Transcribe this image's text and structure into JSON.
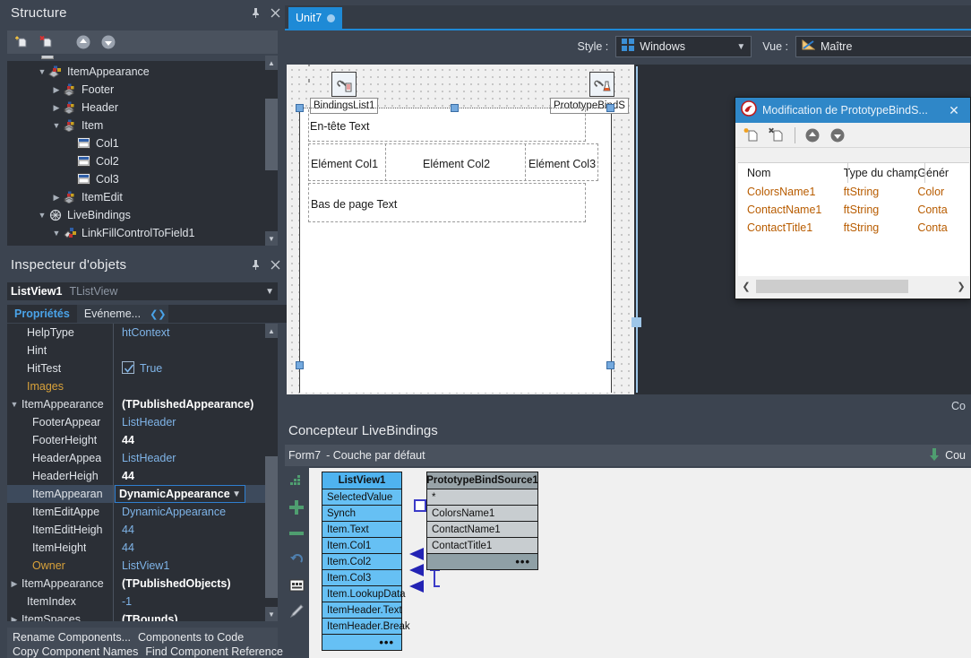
{
  "structure": {
    "title": "Structure",
    "toolbar": [
      {
        "name": "new-item-icon",
        "tip": "New item"
      },
      {
        "name": "delete-item-icon",
        "tip": "Delete item"
      },
      {
        "name": "move-up-icon",
        "tip": "Move up"
      },
      {
        "name": "move-down-icon",
        "tip": "Move down"
      }
    ],
    "tree": [
      {
        "label": "ItemAppearance",
        "indent": 2,
        "expander": "v",
        "icon": "component-icon"
      },
      {
        "label": "Footer",
        "indent": 3,
        "expander": ">",
        "icon": "appearance-icon"
      },
      {
        "label": "Header",
        "indent": 3,
        "expander": ">",
        "icon": "appearance-icon"
      },
      {
        "label": "Item",
        "indent": 3,
        "expander": "v",
        "icon": "appearance-icon"
      },
      {
        "label": "Col1",
        "indent": 4,
        "expander": "",
        "icon": "object-icon"
      },
      {
        "label": "Col2",
        "indent": 4,
        "expander": "",
        "icon": "object-icon"
      },
      {
        "label": "Col3",
        "indent": 4,
        "expander": "",
        "icon": "object-icon"
      },
      {
        "label": "ItemEdit",
        "indent": 3,
        "expander": ">",
        "icon": "appearance-icon"
      },
      {
        "label": "LiveBindings",
        "indent": 2,
        "expander": "v",
        "icon": "livebindings-icon"
      },
      {
        "label": "LinkFillControlToField1",
        "indent": 3,
        "expander": "v",
        "icon": "link-icon"
      }
    ]
  },
  "inspector": {
    "title": "Inspecteur d'objets",
    "component": {
      "name": "ListView1",
      "type": "TListView"
    },
    "tabs": [
      {
        "label": "Propriétés",
        "active": true
      },
      {
        "label": "Evéneme...",
        "active": false
      }
    ],
    "search_value": "",
    "search_placeholder": "",
    "rows": [
      {
        "key": "HelpType",
        "value": "htContext",
        "style": "lite",
        "indent": 1,
        "expander": "",
        "selected": false
      },
      {
        "key": "Hint",
        "value": "",
        "style": "lite",
        "indent": 1,
        "expander": "",
        "selected": false
      },
      {
        "key": "HitTest",
        "value": "True",
        "style": "check",
        "indent": 1,
        "expander": "",
        "selected": false
      },
      {
        "key": "Images",
        "value": "",
        "style": "lite",
        "indent": 1,
        "expander": "",
        "selected": false,
        "keyColor": "orange"
      },
      {
        "key": "ItemAppearance",
        "value": "(TPublishedAppearance)",
        "style": "bold",
        "indent": 0,
        "expander": "v",
        "selected": false
      },
      {
        "key": "FooterAppear",
        "value": "ListHeader",
        "style": "lite",
        "indent": 2,
        "expander": "",
        "selected": false
      },
      {
        "key": "FooterHeight",
        "value": "44",
        "style": "num",
        "indent": 2,
        "expander": "",
        "selected": false
      },
      {
        "key": "HeaderAppea",
        "value": "ListHeader",
        "style": "lite",
        "indent": 2,
        "expander": "",
        "selected": false
      },
      {
        "key": "HeaderHeigh",
        "value": "44",
        "style": "num",
        "indent": 2,
        "expander": "",
        "selected": false
      },
      {
        "key": "ItemAppearan",
        "value": "DynamicAppearance",
        "style": "dropdown",
        "indent": 2,
        "expander": "",
        "selected": true
      },
      {
        "key": "ItemEditAppe",
        "value": "DynamicAppearance",
        "style": "lite",
        "indent": 2,
        "expander": "",
        "selected": false
      },
      {
        "key": "ItemEditHeigh",
        "value": "44",
        "style": "lite",
        "indent": 2,
        "expander": "",
        "selected": false
      },
      {
        "key": "ItemHeight",
        "value": "44",
        "style": "lite",
        "indent": 2,
        "expander": "",
        "selected": false
      },
      {
        "key": "Owner",
        "value": "ListView1",
        "style": "lite",
        "indent": 2,
        "expander": "",
        "selected": false,
        "keyColor": "orange"
      },
      {
        "key": "ItemAppearance",
        "value": "(TPublishedObjects)",
        "style": "bold",
        "indent": 0,
        "expander": ">",
        "selected": false
      },
      {
        "key": "ItemIndex",
        "value": "-1",
        "style": "lite",
        "indent": 1,
        "expander": "",
        "selected": false
      },
      {
        "key": "ItemSpaces",
        "value": "(TBounds)",
        "style": "bold",
        "indent": 0,
        "expander": ">",
        "selected": false
      }
    ],
    "status_links": [
      [
        "Rename Components...",
        "Components to Code"
      ],
      [
        "Copy Component Names",
        "Find Component Reference"
      ]
    ]
  },
  "editor": {
    "tab": {
      "label": "Unit7",
      "modified_dot": true
    },
    "toolbar": {
      "style_label": "Style :",
      "style_value": "Windows",
      "view_label": "Vue :",
      "view_value": "Maître"
    }
  },
  "designer": {
    "components": [
      {
        "name": "BindingsList1",
        "icon": "bindings-list-icon"
      },
      {
        "name": "PrototypeBindS",
        "icon": "prototype-bind-source-icon"
      }
    ],
    "listview": {
      "header_text": "En-tête Text",
      "item_cols": [
        "Elément Col1",
        "Elément Col2",
        "Elément Col3"
      ],
      "footer_text": "Bas de page Text"
    },
    "corner_label": "Co"
  },
  "dialog": {
    "title": "Modification de PrototypeBindS...",
    "icon": "prototype-bind-source-icon",
    "close_label": "✕",
    "toolbar": [
      {
        "name": "add-field-icon"
      },
      {
        "name": "delete-field-icon"
      },
      {
        "name": "move-up-icon"
      },
      {
        "name": "move-down-icon"
      }
    ],
    "columns": [
      "Nom",
      "Type du champ",
      "Génér"
    ],
    "rows": [
      {
        "nom": "ColorsName1",
        "type": "ftString",
        "gen": "Color"
      },
      {
        "nom": "ContactName1",
        "type": "ftString",
        "gen": "Conta"
      },
      {
        "nom": "ContactTitle1",
        "type": "ftString",
        "gen": "Conta"
      }
    ]
  },
  "livebindings": {
    "title": "Concepteur LiveBindings",
    "toolbar": {
      "form": "Form7",
      "layer": "- Couche par défaut",
      "right_label": "Cou"
    },
    "rail": [
      {
        "name": "grid-toggle-icon"
      },
      {
        "name": "add-binding-icon"
      },
      {
        "name": "remove-binding-icon"
      },
      {
        "name": "undo-icon"
      },
      {
        "name": "show-all-icon"
      },
      {
        "name": "edit-icon"
      }
    ],
    "boxes": [
      {
        "title": "ListView1",
        "kind": "control",
        "rows": [
          "SelectedValue",
          "Synch",
          "Item.Text",
          "Item.Col1",
          "Item.Col2",
          "Item.Col3",
          "Item.LookupData",
          "ItemHeader.Text",
          "ItemHeader.Break"
        ],
        "more": "•••"
      },
      {
        "title": "PrototypeBindSource1",
        "kind": "source",
        "rows": [
          "*",
          "ColorsName1",
          "ContactName1",
          "ContactTitle1"
        ],
        "more": "•••"
      }
    ],
    "links": [
      {
        "from": "Item.Col1",
        "to": "ColorsName1"
      },
      {
        "from": "Item.Col2",
        "to": "ContactName1"
      },
      {
        "from": "Item.Col3",
        "to": "ContactTitle1"
      }
    ]
  },
  "colors": {
    "accent": "#1e8ad6",
    "panel_bg": "#3c4450",
    "grid_bg": "#2b2f36",
    "value_blue": "#7fb4e8",
    "orange_key": "#d9a23a",
    "dialog_title": "#2f87c8",
    "bind_blue": "#66c0f4",
    "bind_gray": "#c8cdd0"
  }
}
